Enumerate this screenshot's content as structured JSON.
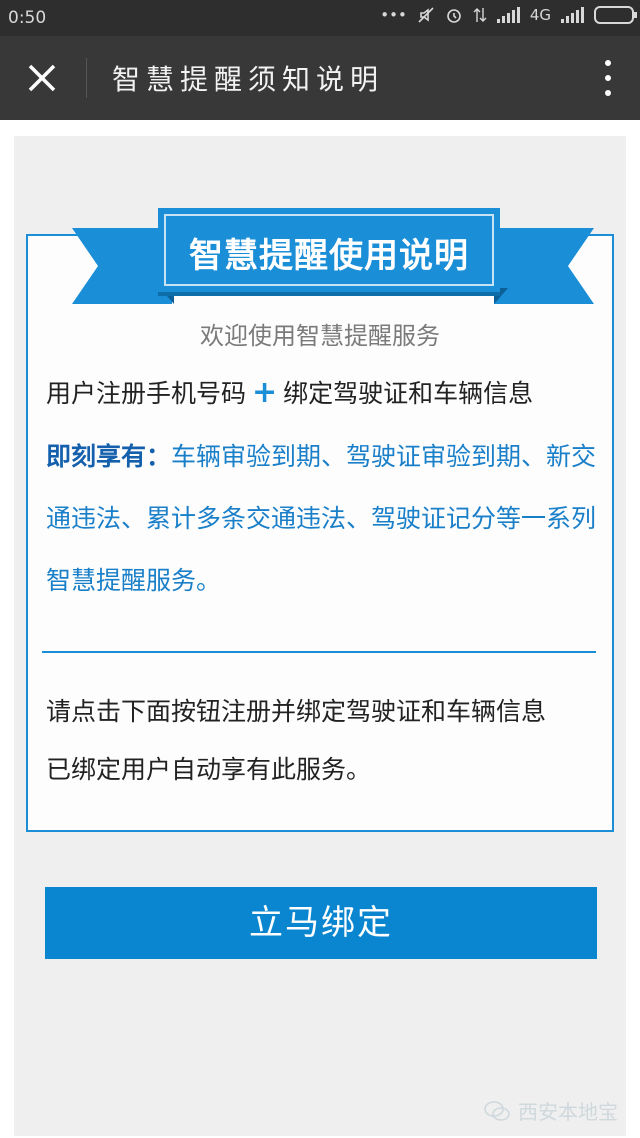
{
  "status_bar": {
    "time": "0:50",
    "network": "4G"
  },
  "nav": {
    "title": "智慧提醒须知说明",
    "close_icon": "close-icon",
    "more_icon": "more-vertical-icon"
  },
  "poster": {
    "ribbon_title": "智慧提醒使用说明",
    "welcome": "欢迎使用智慧提醒服务",
    "line1_part1": "用户注册手机号码",
    "plus": "+",
    "line1_part2": "绑定驾驶证和车辆信息",
    "benefit_lead": "即刻享有：",
    "benefit_text": "车辆审验到期、驾驶证审验到期、新交通违法、累计多条交通违法、驾驶证记分等一系列智慧提醒服务。",
    "instruction1": "请点击下面按钮注册并绑定驾驶证和车辆信息",
    "instruction2": "已绑定用户自动享有此服务。",
    "button_label": "立马绑定",
    "watermark": "西安本地宝"
  },
  "colors": {
    "accent": "#1a8ed6",
    "button": "#0a86d0",
    "nav_bg": "#383838",
    "status_bg": "#2e2e2e"
  }
}
